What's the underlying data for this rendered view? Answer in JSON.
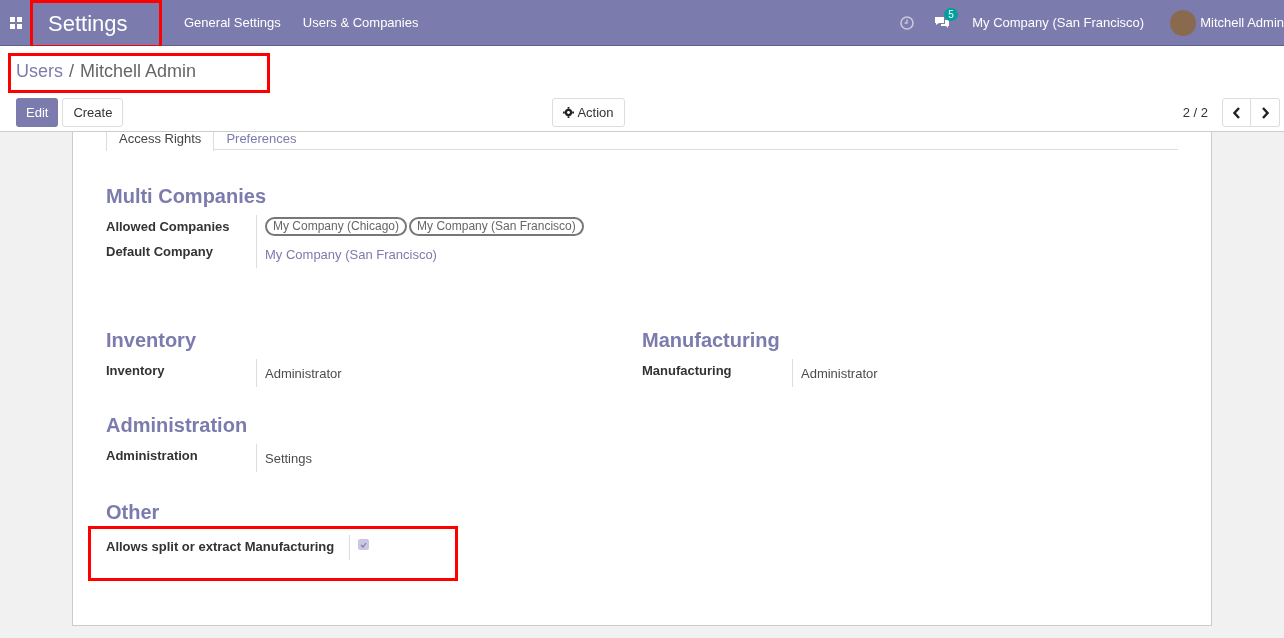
{
  "navbar": {
    "app_title": "Settings",
    "menu": [
      "General Settings",
      "Users & Companies"
    ],
    "chat_count": "5",
    "company": "My Company (San Francisco)",
    "user": "Mitchell Admin"
  },
  "breadcrumb": {
    "parent": "Users",
    "separator": "/",
    "current": "Mitchell Admin"
  },
  "buttons": {
    "edit": "Edit",
    "create": "Create",
    "action": "Action"
  },
  "pager": "2 / 2",
  "tabs": [
    {
      "label": "Access Rights",
      "selected": true
    },
    {
      "label": "Preferences",
      "selected": false
    }
  ],
  "rows": [
    {
      "groups": [
        {
          "title": "Multi Companies",
          "fields": [
            {
              "label": "Allowed Companies",
              "kind": "tags",
              "values": [
                "My Company (Chicago)",
                "My Company (San Francisco)"
              ]
            },
            {
              "label": "Default Company",
              "kind": "link",
              "value": "My Company (San Francisco)"
            }
          ]
        }
      ]
    },
    {
      "groups": [
        {
          "title": "Inventory",
          "fields": [
            {
              "label": "Inventory",
              "kind": "text",
              "value": "Administrator"
            }
          ]
        },
        {
          "title": "Manufacturing",
          "fields": [
            {
              "label": "Manufacturing",
              "kind": "text",
              "value": "Administrator"
            }
          ]
        }
      ]
    },
    {
      "groups": [
        {
          "title": "Administration",
          "fields": [
            {
              "label": "Administration",
              "kind": "text",
              "value": "Settings"
            }
          ]
        }
      ]
    },
    {
      "groups": [
        {
          "title": "Other",
          "fields": [
            {
              "label": "Allows split or extract Manufacturing",
              "kind": "checkbox",
              "checked": true
            }
          ]
        }
      ]
    }
  ]
}
